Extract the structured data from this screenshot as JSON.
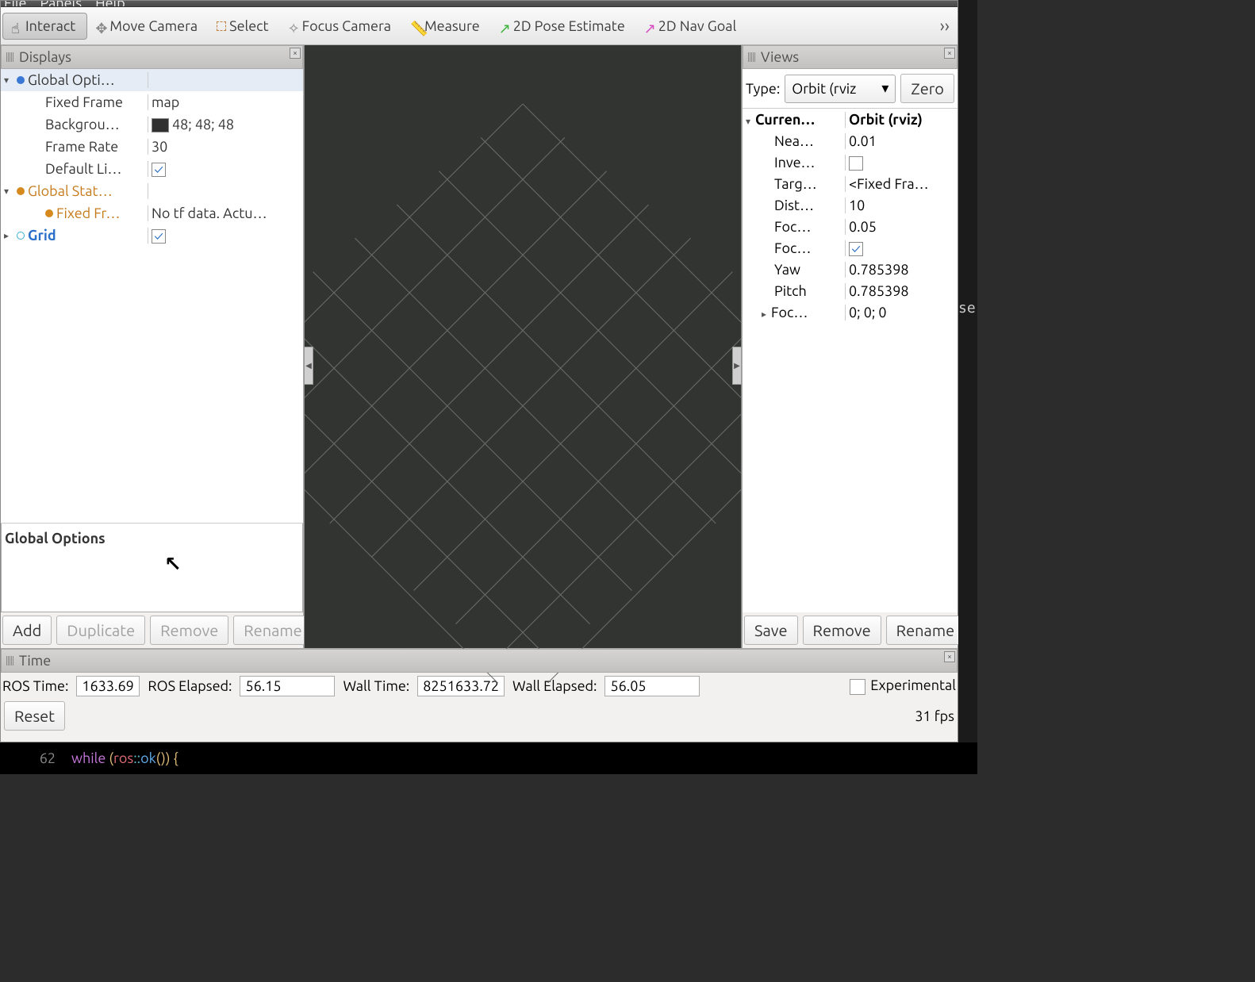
{
  "menubar": {
    "file": "File",
    "panels": "Panels",
    "help": "Help"
  },
  "toolbar": {
    "interact": "Interact",
    "move": "Move Camera",
    "select": "Select",
    "focus": "Focus Camera",
    "measure": "Measure",
    "pose": "2D Pose Estimate",
    "nav": "2D Nav Goal",
    "overflow": "››"
  },
  "displays": {
    "title": "Displays",
    "global_options": "Global Opti…",
    "fixed_frame_k": "Fixed Frame",
    "fixed_frame_v": "map",
    "background_k": "Backgrou…",
    "background_v": "48; 48; 48",
    "frame_rate_k": "Frame Rate",
    "frame_rate_v": "30",
    "default_light_k": "Default Li…",
    "global_status": "Global Stat…",
    "fixed_fr_k": "Fixed Fr…",
    "fixed_fr_v": "No tf data.  Actu…",
    "grid": "Grid",
    "desc_title": "Global Options",
    "add": "Add",
    "duplicate": "Duplicate",
    "remove": "Remove",
    "rename": "Rename"
  },
  "views": {
    "title": "Views",
    "type_label": "Type:",
    "type_value": "Orbit (rviz",
    "zero": "Zero",
    "current_k": "Curren…",
    "current_v": "Orbit (rviz)",
    "near_k": "Nea…",
    "near_v": "0.01",
    "invert_k": "Inve…",
    "target_k": "Targ…",
    "target_v": "<Fixed Fra…",
    "dist_k": "Dist…",
    "dist_v": "10",
    "focal_k": "Foc…",
    "focal_v": "0.05",
    "focal2_k": "Foc…",
    "yaw_k": "Yaw",
    "yaw_v": "0.785398",
    "pitch_k": "Pitch",
    "pitch_v": "0.785398",
    "focus_k": "Foc…",
    "focus_v": "0; 0; 0",
    "save": "Save",
    "remove": "Remove",
    "rename": "Rename"
  },
  "time": {
    "title": "Time",
    "ros_time_k": "ROS Time:",
    "ros_time_v": "1633.69",
    "ros_elapsed_k": "ROS Elapsed:",
    "ros_elapsed_v": "56.15",
    "wall_time_k": "Wall Time:",
    "wall_time_v": "8251633.72",
    "wall_elapsed_k": "Wall Elapsed:",
    "wall_elapsed_v": "56.05",
    "experimental": "Experimental",
    "reset": "Reset",
    "fps": "31 fps"
  },
  "editor": {
    "lineno": "62",
    "code_while": "while ",
    "code_paren": "(",
    "code_ros": "ros",
    "code_scope": "::",
    "code_ok": "ok",
    "code_call": "()) ",
    "code_brace": "{"
  },
  "side": {
    "text": "se"
  }
}
